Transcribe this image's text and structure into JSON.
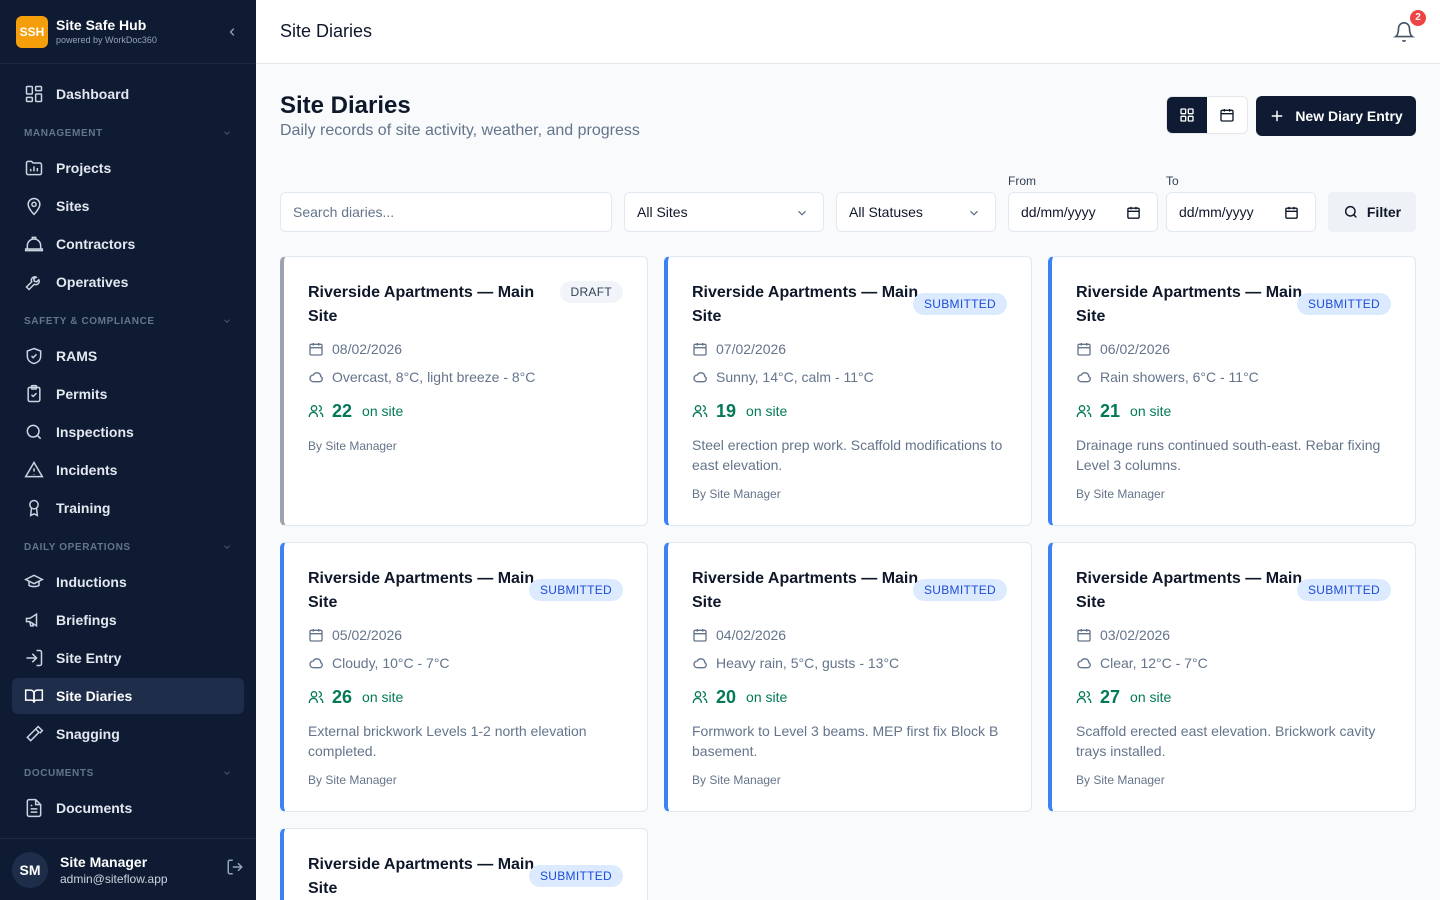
{
  "app": {
    "logo_text": "SSH",
    "name": "Site Safe Hub",
    "powered_by": "powered by WorkDoc360"
  },
  "nav": {
    "dashboard": "Dashboard",
    "sections": {
      "management": "MANAGEMENT",
      "safety": "SAFETY & COMPLIANCE",
      "daily": "DAILY OPERATIONS",
      "documents": "DOCUMENTS"
    },
    "items": {
      "projects": "Projects",
      "sites": "Sites",
      "contractors": "Contractors",
      "operatives": "Operatives",
      "rams": "RAMS",
      "permits": "Permits",
      "inspections": "Inspections",
      "incidents": "Incidents",
      "training": "Training",
      "inductions": "Inductions",
      "briefings": "Briefings",
      "site_entry": "Site Entry",
      "site_diaries": "Site Diaries",
      "snagging": "Snagging",
      "documents": "Documents"
    }
  },
  "user": {
    "initials": "SM",
    "name": "Site Manager",
    "email": "admin@siteflow.app"
  },
  "topbar": {
    "title": "Site Diaries",
    "notification_count": "2"
  },
  "page": {
    "title": "Site Diaries",
    "subtitle": "Daily records of site activity, weather, and progress",
    "new_button": "New Diary Entry"
  },
  "filters": {
    "search_placeholder": "Search diaries...",
    "site_select": "All Sites",
    "status_select": "All Statuses",
    "from_label": "From",
    "to_label": "To",
    "from_value": "dd/mm/yyyy",
    "to_value": "dd/mm/yyyy",
    "filter_button": "Filter"
  },
  "diaries": [
    {
      "title": "Riverside Apartments — Main Site",
      "status": "DRAFT",
      "date": "08/02/2026",
      "weather": "Overcast, 8°C, light breeze - 8°C",
      "workers": "22",
      "on_site": "on site",
      "notes": "",
      "author": "By Site Manager"
    },
    {
      "title": "Riverside Apartments — Main Site",
      "status": "SUBMITTED",
      "date": "07/02/2026",
      "weather": "Sunny, 14°C, calm - 11°C",
      "workers": "19",
      "on_site": "on site",
      "notes": "Steel erection prep work. Scaffold modifications to east elevation.",
      "author": "By Site Manager"
    },
    {
      "title": "Riverside Apartments — Main Site",
      "status": "SUBMITTED",
      "date": "06/02/2026",
      "weather": "Rain showers, 6°C - 11°C",
      "workers": "21",
      "on_site": "on site",
      "notes": "Drainage runs continued south-east. Rebar fixing Level 3 columns.",
      "author": "By Site Manager"
    },
    {
      "title": "Riverside Apartments — Main Site",
      "status": "SUBMITTED",
      "date": "05/02/2026",
      "weather": "Cloudy, 10°C - 7°C",
      "workers": "26",
      "on_site": "on site",
      "notes": "External brickwork Levels 1-2 north elevation completed.",
      "author": "By Site Manager"
    },
    {
      "title": "Riverside Apartments — Main Site",
      "status": "SUBMITTED",
      "date": "04/02/2026",
      "weather": "Heavy rain, 5°C, gusts - 13°C",
      "workers": "20",
      "on_site": "on site",
      "notes": "Formwork to Level 3 beams. MEP first fix Block B basement.",
      "author": "By Site Manager"
    },
    {
      "title": "Riverside Apartments — Main Site",
      "status": "SUBMITTED",
      "date": "03/02/2026",
      "weather": "Clear, 12°C - 7°C",
      "workers": "27",
      "on_site": "on site",
      "notes": "Scaffold erected east elevation. Brickwork cavity trays installed.",
      "author": "By Site Manager"
    },
    {
      "title": "Riverside Apartments — Main Site",
      "status": "SUBMITTED",
      "date": "",
      "weather": "",
      "workers": "",
      "on_site": "",
      "notes": "",
      "author": ""
    }
  ],
  "colors": {
    "sidebar_bg": "#0f1b33",
    "accent_blue": "#3b82f6",
    "worker_green": "#047857",
    "brand_orange": "#f59e0b",
    "alert_red": "#ef4444"
  }
}
